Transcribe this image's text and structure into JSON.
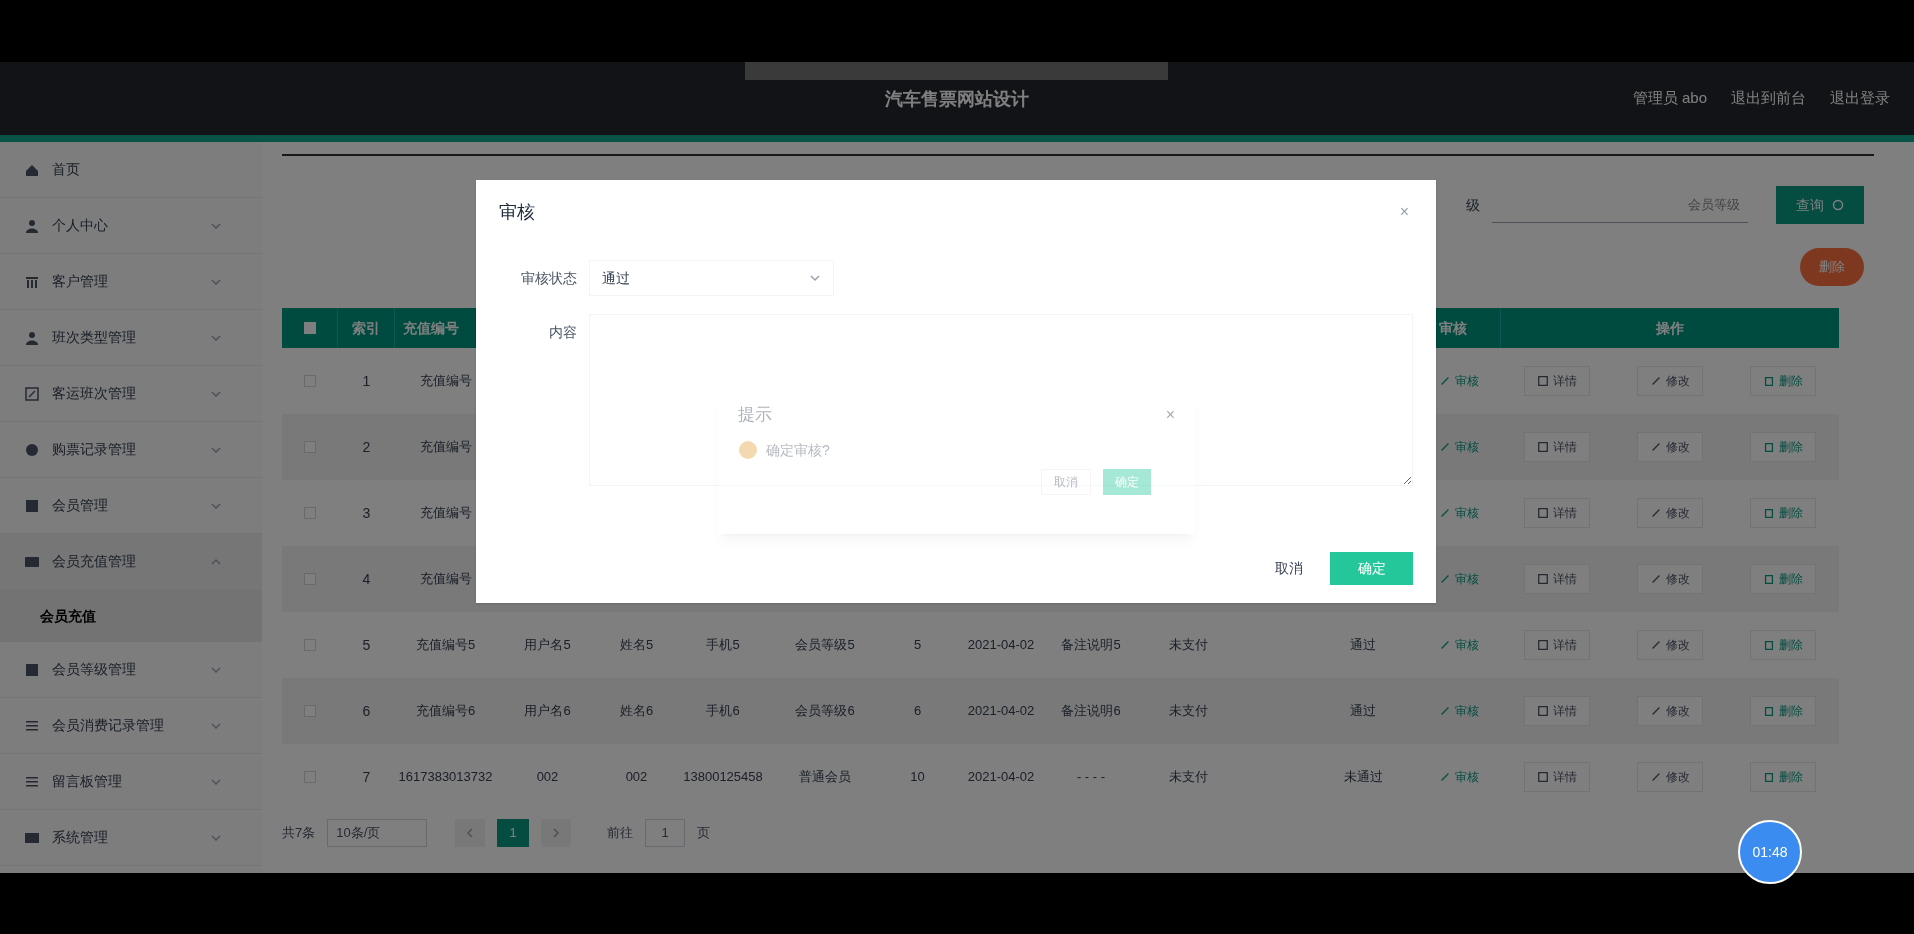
{
  "header": {
    "title": "汽车售票网站设计",
    "user": "管理员 abo",
    "links": [
      "退出到前台",
      "退出登录"
    ]
  },
  "sidebar": {
    "items": [
      {
        "label": "首页",
        "kind": "home"
      },
      {
        "label": "个人中心",
        "kind": "user",
        "expanded": false
      },
      {
        "label": "客户管理",
        "kind": "grid",
        "expanded": false
      },
      {
        "label": "班次类型管理",
        "kind": "user",
        "expanded": false
      },
      {
        "label": "客运班次管理",
        "kind": "edit",
        "expanded": false
      },
      {
        "label": "购票记录管理",
        "kind": "globe",
        "expanded": false
      },
      {
        "label": "会员管理",
        "kind": "square",
        "expanded": false
      },
      {
        "label": "会员充值管理",
        "kind": "card",
        "expanded": true,
        "children": [
          {
            "label": "会员充值",
            "selected": true
          }
        ]
      },
      {
        "label": "会员等级管理",
        "kind": "square",
        "expanded": false
      },
      {
        "label": "会员消费记录管理",
        "kind": "list",
        "expanded": false
      },
      {
        "label": "留言板管理",
        "kind": "list",
        "expanded": false
      },
      {
        "label": "系统管理",
        "kind": "card",
        "expanded": false
      }
    ]
  },
  "search": {
    "label": "级",
    "placeholder": "会员等级",
    "button": "查询"
  },
  "delete_button": "删除",
  "table": {
    "all_checked": false,
    "columns": [
      "索引",
      "充值编号",
      "审核",
      "操作"
    ],
    "rows": [
      {
        "checked": false,
        "index": "1",
        "number": "充值编号",
        "review": "审核",
        "actions": [
          "详情",
          "修改",
          "删除"
        ]
      },
      {
        "checked": false,
        "index": "2",
        "number": "充值编号",
        "review": "审核",
        "actions": [
          "详情",
          "修改",
          "删除"
        ]
      },
      {
        "checked": false,
        "index": "3",
        "number": "充值编号",
        "review": "审核",
        "actions": [
          "详情",
          "修改",
          "删除"
        ]
      },
      {
        "checked": false,
        "index": "4",
        "number": "充值编号",
        "review": "审核",
        "actions": [
          "详情",
          "修改",
          "删除"
        ]
      },
      {
        "checked": false,
        "index": "5",
        "number": "充值编号5",
        "cells": [
          "用户名5",
          "姓名5",
          "手机5",
          "会员等级5",
          "5",
          "2021-04-02",
          "备注说明5",
          "未支付",
          "",
          "通过"
        ],
        "review": "审核",
        "actions": [
          "详情",
          "修改",
          "删除"
        ]
      },
      {
        "checked": false,
        "index": "6",
        "number": "充值编号6",
        "cells": [
          "用户名6",
          "姓名6",
          "手机6",
          "会员等级6",
          "6",
          "2021-04-02",
          "备注说明6",
          "未支付",
          "",
          "通过"
        ],
        "review": "审核",
        "actions": [
          "详情",
          "修改",
          "删除"
        ]
      },
      {
        "checked": false,
        "index": "7",
        "number": "1617383013732",
        "cells": [
          "002",
          "002",
          "13800125458",
          "普通会员",
          "10",
          "2021-04-02",
          "- - - -",
          "未支付",
          "",
          "未通过"
        ],
        "review": "审核",
        "actions": [
          "详情",
          "修改",
          "删除"
        ]
      }
    ]
  },
  "pagination": {
    "total": "共7条",
    "page_size": "10条/页",
    "pages": [
      {
        "label": "1",
        "selected": true
      }
    ],
    "goto": "前往",
    "goto_value": "1",
    "goto_suffix": "页"
  },
  "dialog": {
    "title": "审核",
    "close": "×",
    "fields": [
      {
        "label": "审核状态",
        "kind": "select",
        "value": "通过"
      },
      {
        "label": "内容",
        "kind": "textarea"
      }
    ],
    "buttons": [
      "取消",
      "确定"
    ]
  },
  "confirm": {
    "title": "提示",
    "close": "×",
    "message": "确定审核?",
    "buttons": [
      "取消",
      "确定"
    ]
  },
  "timer": "01:48"
}
